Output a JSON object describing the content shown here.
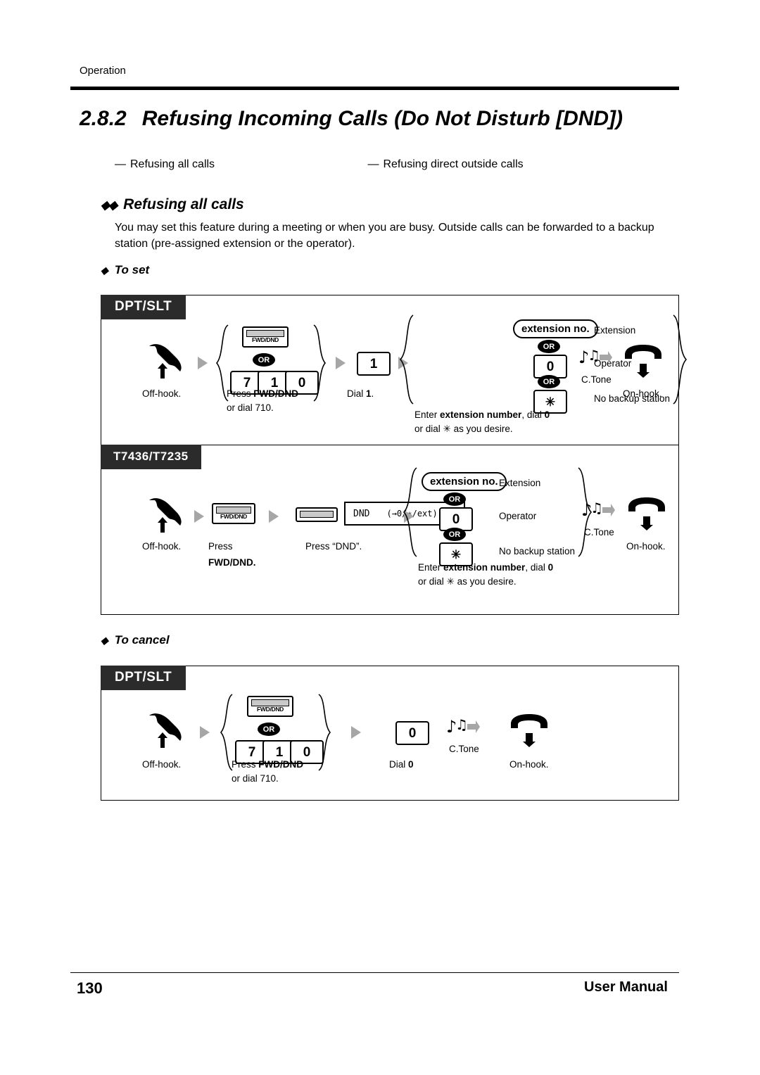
{
  "header": {
    "section": "Operation"
  },
  "title": {
    "number": "2.8.2",
    "text": "Refusing Incoming Calls (Do Not Disturb [DND])"
  },
  "sublinks": [
    {
      "label": "Refusing all calls"
    },
    {
      "label": "Refusing direct outside calls"
    }
  ],
  "section": {
    "heading": "Refusing all calls",
    "intro": "You may set this feature during a meeting or when you are busy. Outside calls can be forwarded to a backup station (pre-assigned extension or the operator)."
  },
  "to_set": {
    "heading": "To set",
    "panel1": {
      "tab": "DPT/SLT",
      "steps": {
        "offhook": "Off-hook.",
        "press_line1_a": "Press ",
        "press_line1_b": "FWD/DND",
        "press_line2": "or dial 710.",
        "fwd_label": "FWD/DND",
        "or": "OR",
        "keys_710": [
          "7",
          "1",
          "0"
        ],
        "dial_line_a": "Dial ",
        "dial_line_b": "1",
        "dial_line_c": ".",
        "key_1": "1",
        "ext_box": "extension no.",
        "ext_label": "Extension",
        "key_0": "0",
        "op_label": "Operator",
        "key_star": "✳",
        "nobackup_label": "No backup station",
        "note_a": "Enter ",
        "note_b": "extension number",
        "note_c": ", dial ",
        "note_d": "0",
        "note2_a": "or dial ",
        "note2_b": "✳",
        "note2_c": " as you desire.",
        "ctone": "C.Tone",
        "onhook": "On-hook."
      }
    },
    "panel2": {
      "tab": "T7436/T7235",
      "steps": {
        "offhook": "Off-hook.",
        "press": "Press",
        "fwd_dnd_bold": "FWD/DND.",
        "fwd_label": "FWD/DND",
        "press_dnd": "Press “DND”.",
        "lcd_left": "DND",
        "lcd_right": "(→0/∗/ext)",
        "ext_box": "extension no.",
        "ext_label": "Extension",
        "or": "OR",
        "key_0": "0",
        "op_label": "Operator",
        "key_star": "✳",
        "nobackup_label": "No backup station",
        "note_a": "Enter ",
        "note_b": "extension number",
        "note_c": ", dial ",
        "note_d": "0",
        "note2_a": "or dial ",
        "note2_b": "✳",
        "note2_c": " as you desire.",
        "ctone": "C.Tone",
        "onhook": "On-hook."
      }
    }
  },
  "to_cancel": {
    "heading": "To cancel",
    "panel": {
      "tab": "DPT/SLT",
      "steps": {
        "offhook": "Off-hook.",
        "press_line1_a": "Press ",
        "press_line1_b": "FWD/DND",
        "press_line2": "or dial 710.",
        "fwd_label": "FWD/DND",
        "or": "OR",
        "keys_710": [
          "7",
          "1",
          "0"
        ],
        "key_0": "0",
        "dial_line_a": "Dial  ",
        "dial_line_b": "0",
        "dial_line_c": ".",
        "ctone": "C.Tone",
        "onhook": "On-hook."
      }
    }
  },
  "footer": {
    "page": "130",
    "right": "User Manual"
  }
}
